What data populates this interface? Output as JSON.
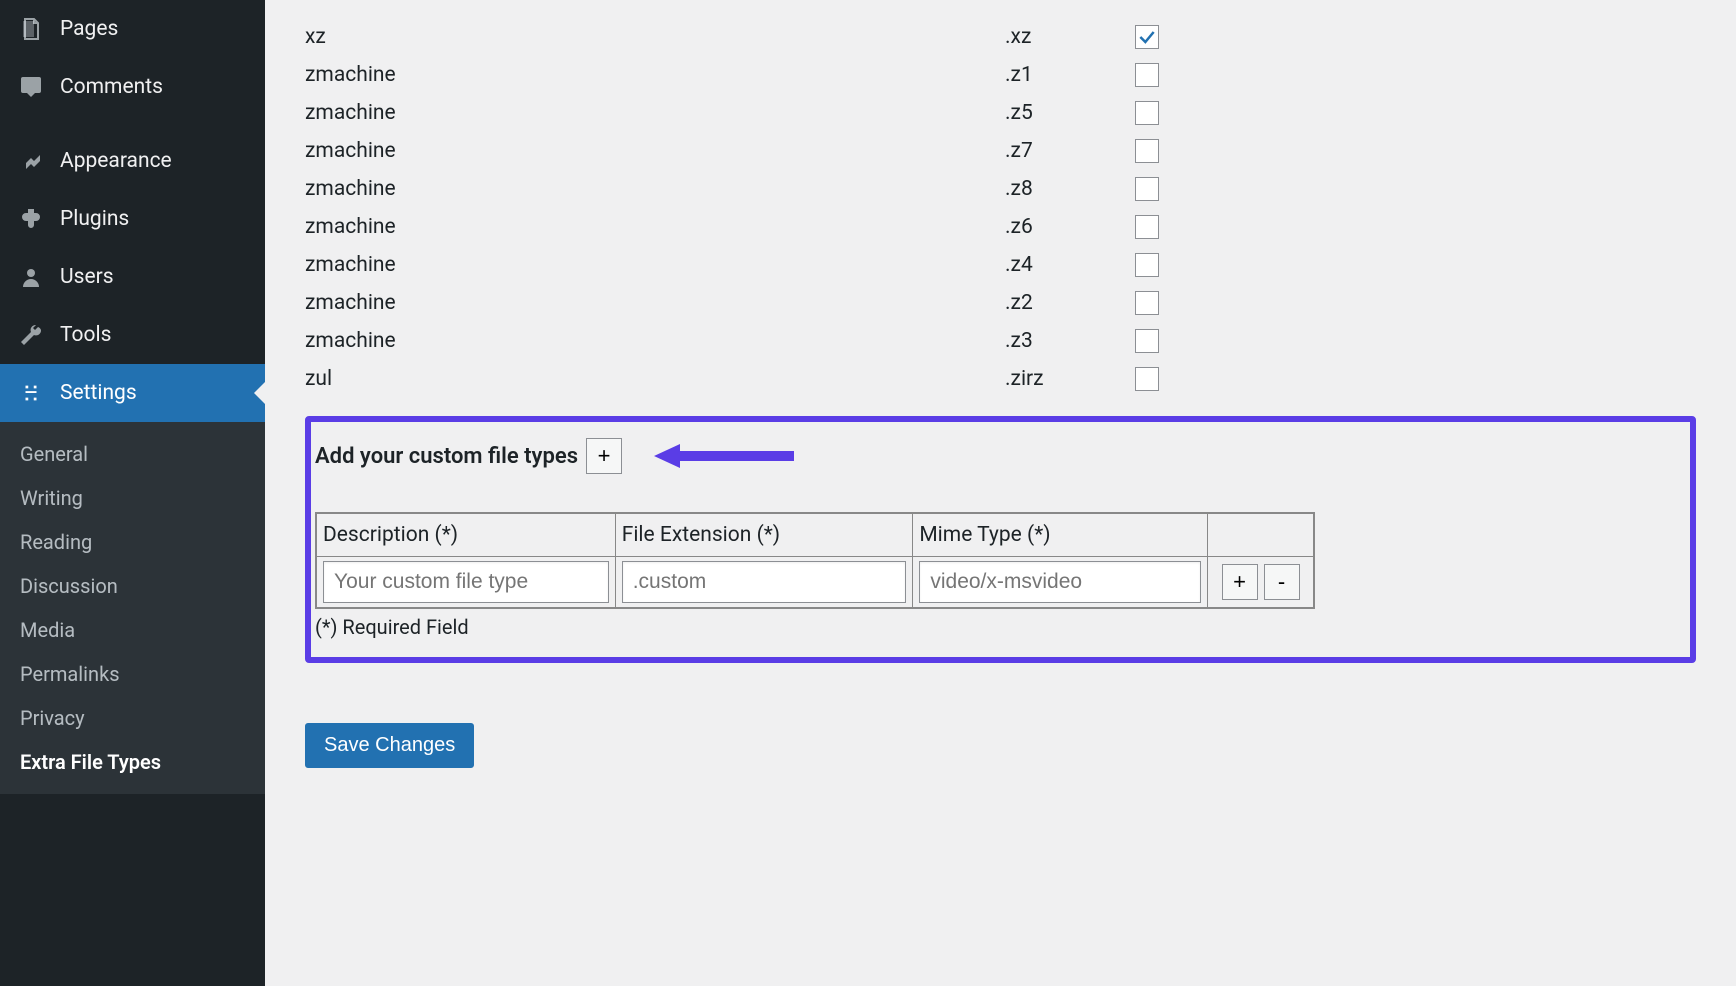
{
  "sidebar": {
    "pages": "Pages",
    "comments": "Comments",
    "appearance": "Appearance",
    "plugins": "Plugins",
    "users": "Users",
    "tools": "Tools",
    "settings": "Settings",
    "submenu": {
      "general": "General",
      "writing": "Writing",
      "reading": "Reading",
      "discussion": "Discussion",
      "media": "Media",
      "permalinks": "Permalinks",
      "privacy": "Privacy",
      "extra_file_types": "Extra File Types"
    }
  },
  "filetypes": [
    {
      "name": "xz",
      "ext": ".xz",
      "checked": true
    },
    {
      "name": "zmachine",
      "ext": ".z1",
      "checked": false
    },
    {
      "name": "zmachine",
      "ext": ".z5",
      "checked": false
    },
    {
      "name": "zmachine",
      "ext": ".z7",
      "checked": false
    },
    {
      "name": "zmachine",
      "ext": ".z8",
      "checked": false
    },
    {
      "name": "zmachine",
      "ext": ".z6",
      "checked": false
    },
    {
      "name": "zmachine",
      "ext": ".z4",
      "checked": false
    },
    {
      "name": "zmachine",
      "ext": ".z2",
      "checked": false
    },
    {
      "name": "zmachine",
      "ext": ".z3",
      "checked": false
    },
    {
      "name": "zul",
      "ext": ".zirz",
      "checked": false
    }
  ],
  "custom": {
    "heading": "Add your custom file types",
    "add_label": "+",
    "cols": {
      "description": "Description (*)",
      "extension": "File Extension (*)",
      "mime": "Mime Type (*)"
    },
    "row": {
      "description_placeholder": "Your custom file type",
      "extension_placeholder": ".custom",
      "mime_placeholder": "video/x-msvideo",
      "add_label": "+",
      "remove_label": "-"
    },
    "required_note": "(*) Required Field"
  },
  "save_label": "Save Changes"
}
